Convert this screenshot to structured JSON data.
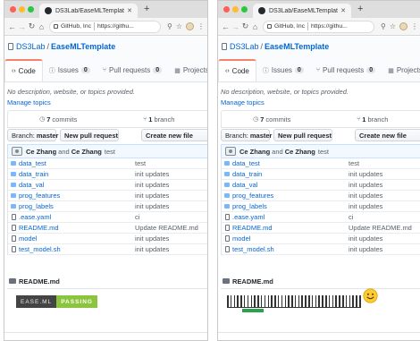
{
  "panes": [
    {
      "id": "left",
      "tab_title": "DS3Lab/EaseMLTemplate",
      "site_name": "GitHub, Inc",
      "url": "https://githu...",
      "repo_owner": "DS3Lab",
      "repo_name": "EaseMLTemplate",
      "nav": {
        "code": "Code",
        "issues": "Issues",
        "issues_count": "0",
        "pulls": "Pull requests",
        "pulls_count": "0",
        "projects": "Projects"
      },
      "description": "No description, website, or topics provided.",
      "manage_topics": "Manage topics",
      "commits_count": "7",
      "commits_label": "commits",
      "branches_count": "1",
      "branches_label": "branch",
      "branch_label": "Branch:",
      "branch_value": "master",
      "new_pr": "New pull request",
      "create_file": "Create new file",
      "commit_author1": "Ce Zhang",
      "commit_and": "and",
      "commit_author2": "Ce Zhang",
      "commit_message": "test",
      "files": [
        {
          "name": "data_test",
          "type": "dir",
          "message": "test"
        },
        {
          "name": "data_train",
          "type": "dir",
          "message": "init updates"
        },
        {
          "name": "data_val",
          "type": "dir",
          "message": "init updates"
        },
        {
          "name": "prog_features",
          "type": "dir",
          "message": "init updates"
        },
        {
          "name": "prog_labels",
          "type": "dir",
          "message": "init updates"
        },
        {
          "name": ".ease.yaml",
          "type": "file",
          "message": "ci"
        },
        {
          "name": "README.md",
          "type": "file",
          "message": "Update README.md"
        },
        {
          "name": "model",
          "type": "file",
          "message": "init updates"
        },
        {
          "name": "test_model.sh",
          "type": "file",
          "message": "init updates"
        }
      ],
      "readme_title": "README.md",
      "badge_left": "EASE.ML",
      "badge_right": "PASSING"
    },
    {
      "id": "right",
      "tab_title": "DS3Lab/EaseMLTemplate",
      "site_name": "GitHub, Inc",
      "url": "https://githu...",
      "repo_owner": "DS3Lab",
      "repo_name": "EaseMLTemplate",
      "nav": {
        "code": "Code",
        "issues": "Issues",
        "issues_count": "0",
        "pulls": "Pull requests",
        "pulls_count": "0",
        "projects": "Projects"
      },
      "description": "No description, website, or topics provided.",
      "manage_topics": "Manage topics",
      "commits_count": "7",
      "commits_label": "commits",
      "branches_count": "1",
      "branches_label": "branch",
      "branch_label": "Branch:",
      "branch_value": "master",
      "new_pr": "New pull request",
      "create_file": "Create new file",
      "commit_author1": "Ce Zhang",
      "commit_and": "and",
      "commit_author2": "Ce Zhang",
      "commit_message": "test",
      "files": [
        {
          "name": "data_test",
          "type": "dir",
          "message": "test"
        },
        {
          "name": "data_train",
          "type": "dir",
          "message": "init updates"
        },
        {
          "name": "data_val",
          "type": "dir",
          "message": "init updates"
        },
        {
          "name": "prog_features",
          "type": "dir",
          "message": "init updates"
        },
        {
          "name": "prog_labels",
          "type": "dir",
          "message": "init updates"
        },
        {
          "name": ".ease.yaml",
          "type": "file",
          "message": "ci"
        },
        {
          "name": "README.md",
          "type": "file",
          "message": "Update README.md"
        },
        {
          "name": "model",
          "type": "file",
          "message": "init updates"
        },
        {
          "name": "test_model.sh",
          "type": "file",
          "message": "init updates"
        }
      ],
      "readme_title": "README.md",
      "meter_ticks": 40,
      "meter_fill_range": [
        0.11,
        0.27
      ]
    }
  ],
  "icons": {
    "back": "arrow-left-icon",
    "forward": "arrow-right-icon",
    "reload": "reload-icon",
    "home": "home-icon",
    "search": "search-icon",
    "star": "star-icon",
    "extension": "extension-icon",
    "menu": "kebab-menu-icon",
    "smile": "smiley-icon"
  },
  "colors": {
    "link": "#0366d6",
    "badge_pass": "#8bc43d",
    "meter_fill": "#2ba24c",
    "active_tab_accent": "#f9826c"
  }
}
